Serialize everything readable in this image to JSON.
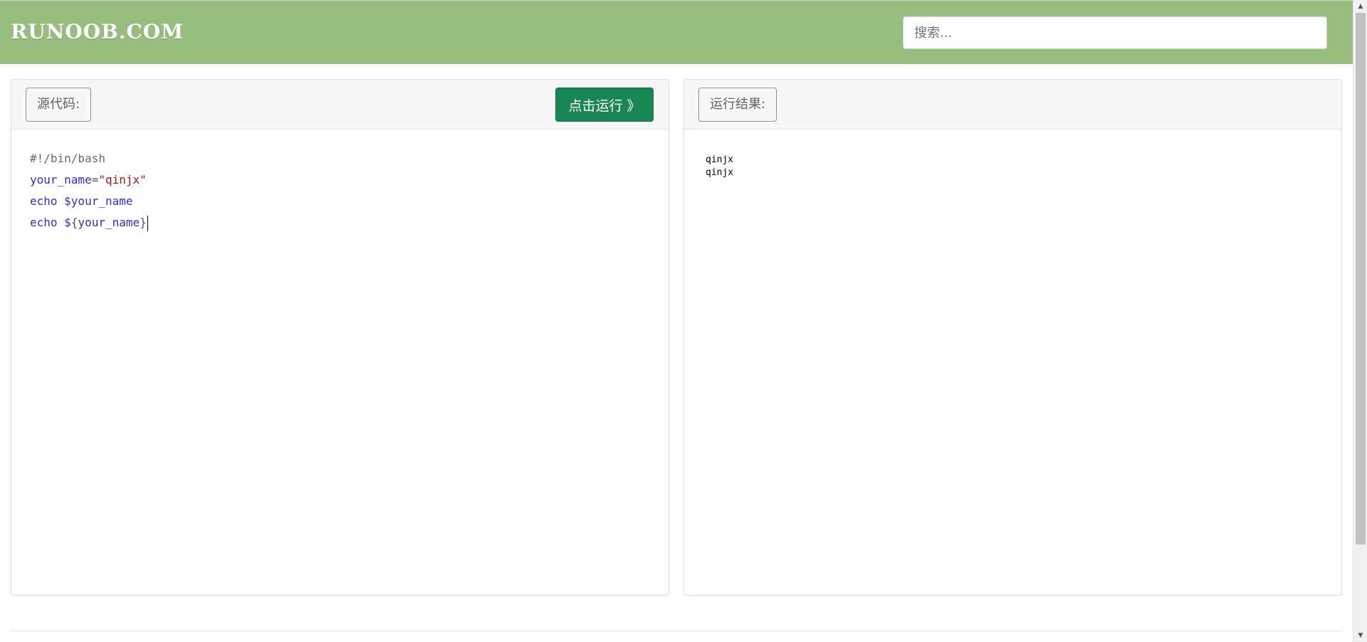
{
  "header": {
    "logo": "RUNOOB.COM",
    "search_placeholder": "搜索..."
  },
  "source_panel": {
    "label": "源代码:",
    "run_button": "点击运行 》",
    "code": {
      "line1": "#!/bin/bash",
      "line2_var": "your_name",
      "line2_eq": "=",
      "line2_str": "\"qinjx\"",
      "line3": "echo $your_name",
      "line4_a": "echo $",
      "line4_b": "{",
      "line4_c": "your_name",
      "line4_d": "}"
    }
  },
  "result_panel": {
    "label": "运行结果:",
    "output_lines": [
      "qinjx",
      "qinjx"
    ]
  },
  "scrollbar": {
    "up_icon": "▲",
    "down_icon": "▼"
  },
  "colors": {
    "header_bg": "#98bd7e",
    "run_button_bg": "#198754",
    "variable": "#2f2fc8",
    "string": "#a31515"
  }
}
